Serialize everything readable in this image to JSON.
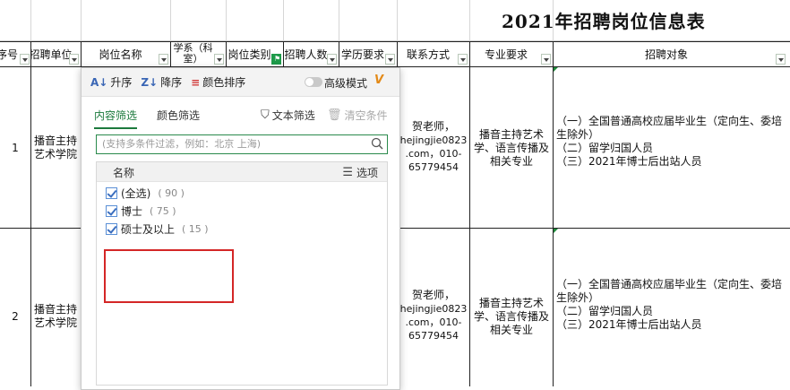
{
  "sheet": {
    "title": "2021年招聘岗位信息表",
    "columns": [
      {
        "key": "seq",
        "label": "序号"
      },
      {
        "key": "unit",
        "label": "招聘单位"
      },
      {
        "key": "position",
        "label": "岗位名称"
      },
      {
        "key": "dept",
        "label": "学系（科室）"
      },
      {
        "key": "type",
        "label": "岗位类别"
      },
      {
        "key": "num",
        "label": "招聘人数"
      },
      {
        "key": "edu",
        "label": "学历要求"
      },
      {
        "key": "contact",
        "label": "联系方式"
      },
      {
        "key": "major",
        "label": "专业要求"
      },
      {
        "key": "target",
        "label": "招聘对象"
      }
    ],
    "rows": [
      {
        "seq": "1",
        "unit": "播音主持艺术学院",
        "contact_line1": "贺老师，",
        "contact_line2": "hejingjie0823",
        "contact_line3": ".com，010-",
        "contact_line4": "65779454",
        "major": "播音主持艺术学、语言传播及相关专业",
        "target_line1": "（一）全国普通高校应届毕业生（定向生、委培",
        "target_line2": "生除外）",
        "target_line3": "（二）留学归国人员",
        "target_line4": "（三）2021年博士后出站人员"
      },
      {
        "seq": "2",
        "unit": "播音主持艺术学院",
        "contact_line1": "贺老师，",
        "contact_line2": "hejingjie0823",
        "contact_line3": ".com，010-",
        "contact_line4": "65779454",
        "major": "播音主持艺术学、语言传播及相关专业",
        "target_line1": "（一）全国普通高校应届毕业生（定向生、委培",
        "target_line2": "生除外）",
        "target_line3": "（二）留学归国人员",
        "target_line4": "（三）2021年博士后出站人员"
      }
    ]
  },
  "filter_popup": {
    "toolbar": {
      "sort_asc": "升序",
      "sort_desc": "降序",
      "color_sort": "颜色排序",
      "advanced_mode": "高级模式",
      "vip_badge": "V"
    },
    "tabs": {
      "content_filter": "内容筛选",
      "color_filter": "颜色筛选",
      "text_filter": "文本筛选",
      "clear_conditions": "清空条件"
    },
    "search": {
      "placeholder": "(支持多条件过滤，例如：北京 上海)"
    },
    "list": {
      "header_name": "名称",
      "header_options": "选项",
      "items": [
        {
          "label": "(全选)",
          "count": "( 90 )",
          "checked": true
        },
        {
          "label": "博士",
          "count": "( 75 )",
          "checked": true
        },
        {
          "label": "硕士及以上",
          "count": "( 15 )",
          "checked": true
        }
      ]
    },
    "highlight_color": "#d42626",
    "accent_color": "#1c7a3d"
  }
}
